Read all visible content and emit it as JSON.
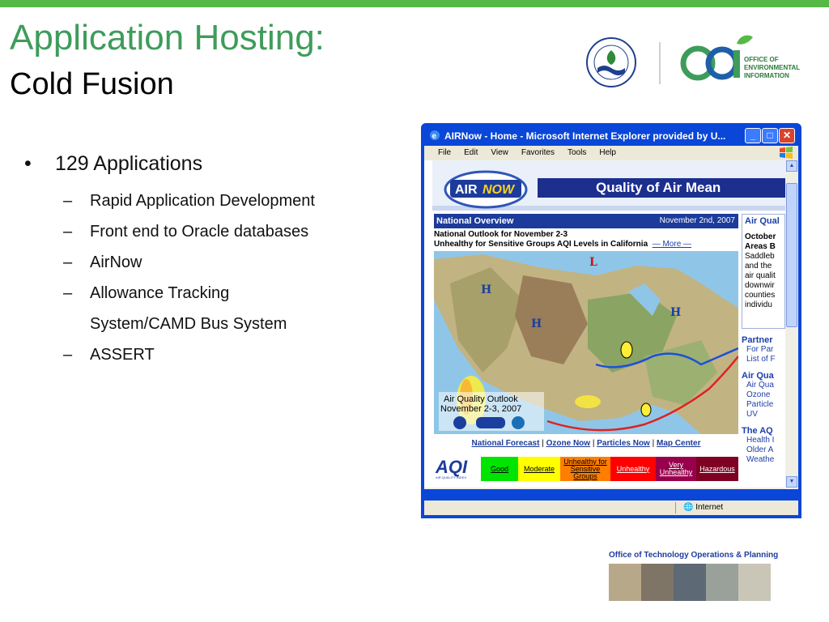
{
  "slide": {
    "title_line1": "Application Hosting:",
    "title_line2": "Cold Fusion",
    "bullets": {
      "main": "129 Applications",
      "subs": [
        "Rapid Application Development",
        "Front end to Oracle databases",
        "AirNow",
        "Allowance Tracking",
        "System/CAMD Bus System",
        "ASSERT"
      ]
    },
    "logo_text": [
      "OFFICE OF",
      "ENVIRONMENTAL",
      "INFORMATION"
    ],
    "footer_text": "Office of Technology Operations & Planning",
    "accent_color": "#56b947",
    "title_color": "#3e9c5a"
  },
  "browser": {
    "title": "AIRNow - Home - Microsoft Internet Explorer provided by U...",
    "menu": [
      "File",
      "Edit",
      "View",
      "Favorites",
      "Tools",
      "Help"
    ],
    "controls": [
      "_",
      "□",
      "✕"
    ],
    "status": "Internet",
    "page": {
      "banner": "Quality of Air Mean",
      "national_overview": "National Overview",
      "date": "November 2nd, 2007",
      "outlook_line1": "National Outlook for November 2-3",
      "outlook_line2": "Unhealthy for Sensitive Groups AQI Levels in California",
      "more_link": "— More —",
      "map_caption_line1": "Air Quality Outlook",
      "map_caption_line2": "November 2-3, 2007",
      "map_links": [
        "National Forecast",
        "Ozone Now",
        "Particles Now",
        "Map Center"
      ],
      "aqi_logo": "AQI",
      "aqi_logo_small": "AIR QUALITY INDEX",
      "aqi_levels": [
        {
          "label": "Good",
          "color": "#00e400",
          "text_color": "#000000"
        },
        {
          "label": "Moderate",
          "color": "#ffff00",
          "text_color": "#000000"
        },
        {
          "label": "Unhealthy for Sensitive Groups",
          "color": "#ff7e00",
          "text_color": "#000000"
        },
        {
          "label": "Unhealthy",
          "color": "#ff0000",
          "text_color": "#ffffff"
        },
        {
          "label": "Very Unhealthy",
          "color": "#99004c",
          "text_color": "#ffffff"
        },
        {
          "label": "Hazardous",
          "color": "#7e0023",
          "text_color": "#ffffff"
        }
      ],
      "right": {
        "head1": "Air Qual",
        "block": [
          "October",
          "Areas B"
        ],
        "text": [
          "Saddleb",
          "and the",
          "air qualit",
          "downwir",
          "counties",
          "individu"
        ],
        "head2": "Partner",
        "links2": [
          "For Par",
          "List of F"
        ],
        "head3": "Air Qua",
        "links3": [
          "Air Qua",
          "Ozone",
          "Particle",
          "UV"
        ],
        "head4": "The AQ",
        "links4": [
          "Health I",
          "Older A",
          "Weathe"
        ]
      }
    }
  }
}
